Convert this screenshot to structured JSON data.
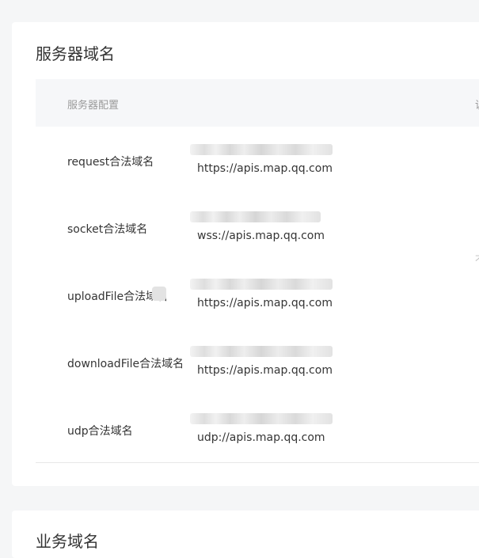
{
  "server_domain_card": {
    "title": "服务器域名",
    "table": {
      "header_config": "服务器配置",
      "header_right": "说",
      "rows": [
        {
          "label": "request合法域名",
          "url": "https://apis.map.qq.com"
        },
        {
          "label": "socket合法域名",
          "url": "wss://apis.map.qq.com"
        },
        {
          "label": "uploadFile合法域名",
          "url": "https://apis.map.qq.com"
        },
        {
          "label": "downloadFile合法域名",
          "url": "https://apis.map.qq.com"
        },
        {
          "label": "udp合法域名",
          "url": "udp://apis.map.qq.com"
        }
      ]
    },
    "side_mark": "不"
  },
  "business_domain_card": {
    "title": "业务域名"
  }
}
